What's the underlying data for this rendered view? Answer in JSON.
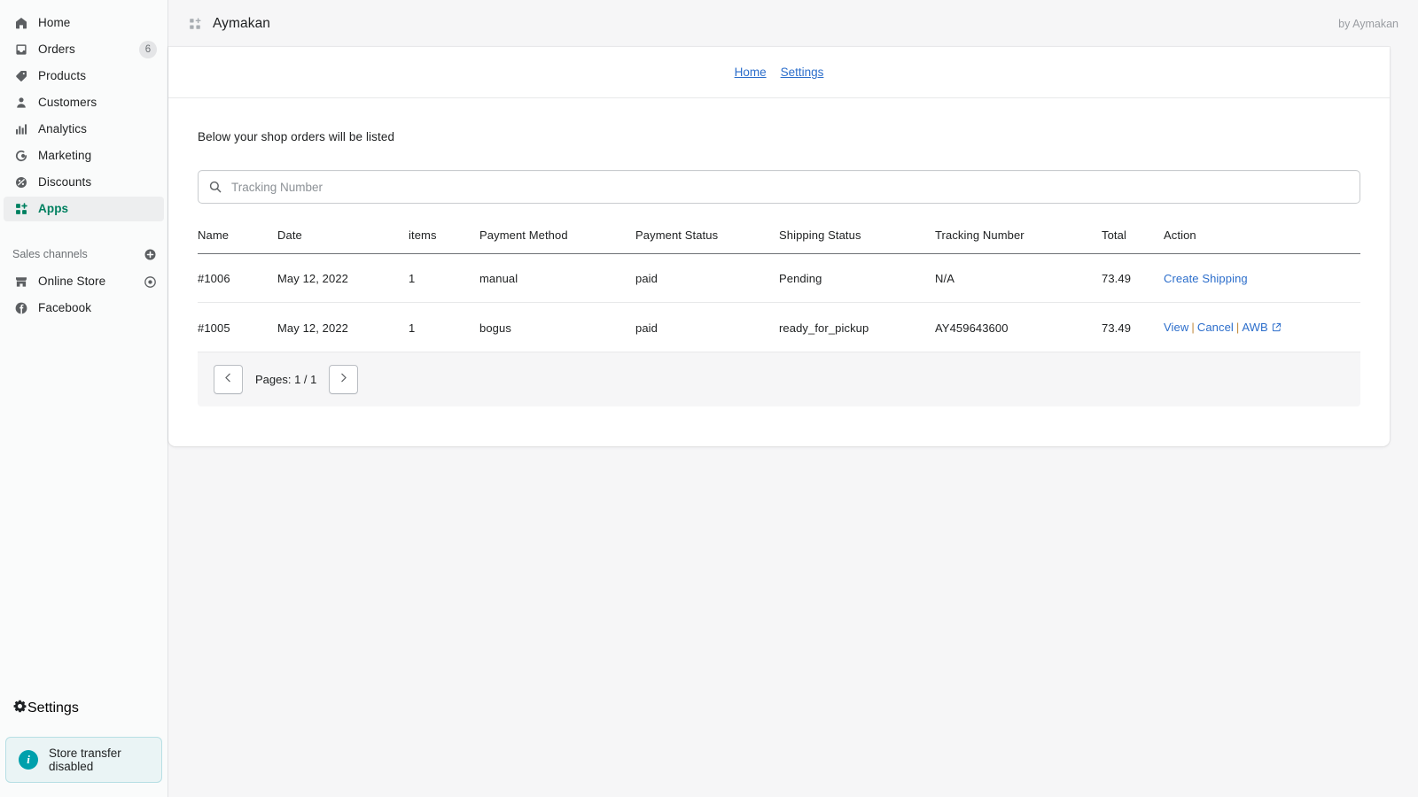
{
  "sidebar": {
    "nav": [
      {
        "label": "Home",
        "icon": "home-icon",
        "badge": null,
        "active": false
      },
      {
        "label": "Orders",
        "icon": "orders-icon",
        "badge": "6",
        "active": false
      },
      {
        "label": "Products",
        "icon": "products-icon",
        "badge": null,
        "active": false
      },
      {
        "label": "Customers",
        "icon": "customers-icon",
        "badge": null,
        "active": false
      },
      {
        "label": "Analytics",
        "icon": "analytics-icon",
        "badge": null,
        "active": false
      },
      {
        "label": "Marketing",
        "icon": "marketing-icon",
        "badge": null,
        "active": false
      },
      {
        "label": "Discounts",
        "icon": "discounts-icon",
        "badge": null,
        "active": false
      },
      {
        "label": "Apps",
        "icon": "apps-icon",
        "badge": null,
        "active": true
      }
    ],
    "sales_channels": {
      "title": "Sales channels",
      "add_icon": "plus-circle-icon",
      "items": [
        {
          "label": "Online Store",
          "icon": "storefront-icon",
          "trailing_icon": "eye-icon"
        },
        {
          "label": "Facebook",
          "icon": "facebook-icon",
          "trailing_icon": null
        }
      ]
    },
    "settings": {
      "label": "Settings",
      "icon": "gear-icon"
    },
    "notice": {
      "text": "Store transfer disabled",
      "icon": "info-icon",
      "accent": "#00a0ac"
    }
  },
  "topbar": {
    "app_icon": "apps-grid-icon",
    "title": "Aymakan",
    "byline": "by Aymakan"
  },
  "card_nav": {
    "links": [
      {
        "label": "Home"
      },
      {
        "label": "Settings"
      }
    ]
  },
  "main": {
    "lead": "Below your shop orders will be listed",
    "search": {
      "icon": "search-icon",
      "placeholder": "Tracking Number",
      "value": ""
    },
    "table": {
      "columns": [
        "Name",
        "Date",
        "items",
        "Payment Method",
        "Payment Status",
        "Shipping Status",
        "Tracking Number",
        "Total",
        "Action"
      ],
      "rows": [
        {
          "name": "#1006",
          "date": "May 12, 2022",
          "items": "1",
          "payment_method": "manual",
          "payment_status": "paid",
          "shipping_status": "Pending",
          "tracking_number": "N/A",
          "total": "73.49",
          "actions": [
            {
              "label": "Create Shipping",
              "external": false
            }
          ]
        },
        {
          "name": "#1005",
          "date": "May 12, 2022",
          "items": "1",
          "payment_method": "bogus",
          "payment_status": "paid",
          "shipping_status": "ready_for_pickup",
          "tracking_number": "AY459643600",
          "total": "73.49",
          "actions": [
            {
              "label": "View",
              "external": false
            },
            {
              "label": "Cancel",
              "external": false
            },
            {
              "label": "AWB",
              "external": true
            }
          ]
        }
      ]
    },
    "pager": {
      "prev_icon": "chevron-left-icon",
      "next_icon": "chevron-right-icon",
      "text": "Pages: 1 / 1"
    }
  },
  "colors": {
    "accent_green": "#008060",
    "link_blue": "#2c6ecb",
    "notice_bg": "#eaf4f5",
    "page_bg": "#f6f6f7"
  }
}
